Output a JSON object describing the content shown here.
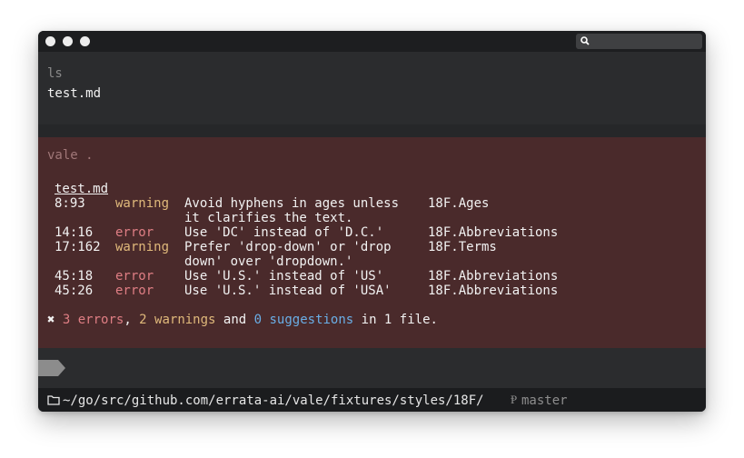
{
  "window": {
    "search_placeholder": ""
  },
  "commands": [
    {
      "command": "ls",
      "output": [
        "test.md"
      ]
    }
  ],
  "vale": {
    "command": "vale .",
    "file": "test.md",
    "rows": [
      {
        "pos": "8:93",
        "level": "warning",
        "message": "Avoid hyphens in ages unless",
        "rule": "18F.Ages"
      },
      {
        "pos": "",
        "level": "",
        "message": "it clarifies the text.",
        "rule": ""
      },
      {
        "pos": "14:16",
        "level": "error",
        "message": "Use 'DC' instead of 'D.C.'",
        "rule": "18F.Abbreviations"
      },
      {
        "pos": "17:162",
        "level": "warning",
        "message": "Prefer 'drop-down' or 'drop",
        "rule": "18F.Terms"
      },
      {
        "pos": "",
        "level": "",
        "message": "down' over 'dropdown.'",
        "rule": ""
      },
      {
        "pos": "45:18",
        "level": "error",
        "message": "Use 'U.S.' instead of 'US'",
        "rule": "18F.Abbreviations"
      },
      {
        "pos": "45:26",
        "level": "error",
        "message": "Use 'U.S.' instead of 'USA'",
        "rule": "18F.Abbreviations"
      }
    ],
    "summary": {
      "icon": "✖",
      "errors": "3 errors",
      "sep1": ", ",
      "warnings": "2 warnings",
      "sep2": " and ",
      "suggestions_count": "0",
      "suggestions_word": " suggestions",
      "tail": " in 1 file."
    }
  },
  "status": {
    "path": "~/go/src/github.com/errata-ai/vale/fixtures/styles/18F/",
    "branch_icon": "Ᵽ",
    "branch": "master"
  },
  "colors": {
    "warning": "#e0b97b",
    "error": "#df7e84",
    "suggestion": "#6aaee6",
    "error_panel": "#4a2a2b"
  }
}
